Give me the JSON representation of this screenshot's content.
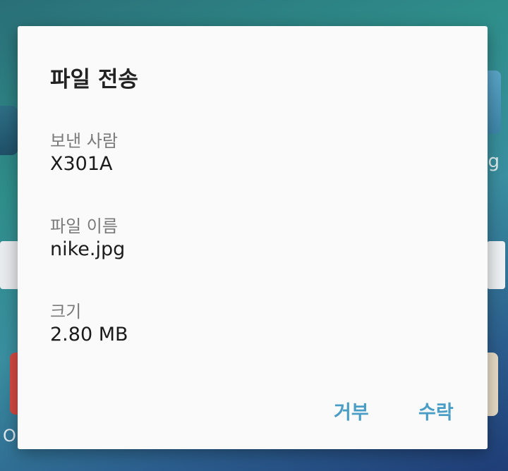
{
  "background": {
    "left_text": "O",
    "right_text": "g"
  },
  "dialog": {
    "title": "파일 전송",
    "fields": [
      {
        "label": "보낸 사람",
        "value": "X301A"
      },
      {
        "label": "파일 이름",
        "value": "nike.jpg"
      },
      {
        "label": "크기",
        "value": "2.80 MB"
      }
    ],
    "buttons": {
      "reject": "거부",
      "accept": "수락"
    },
    "accent_color": "#4a9dc4"
  }
}
